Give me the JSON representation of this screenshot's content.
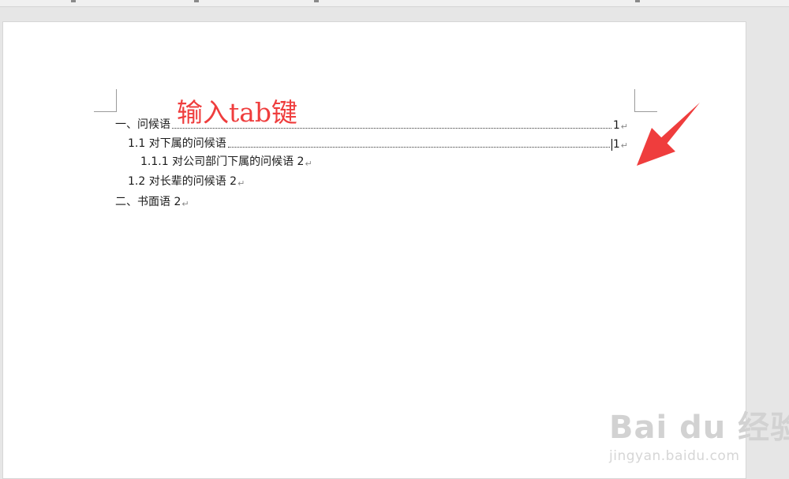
{
  "document": {
    "annotation": "输入tab键",
    "toc": [
      {
        "text": "一、问候语",
        "page": "1",
        "mark": "↵",
        "cursor": false
      },
      {
        "text": "1.1 对下属的问候语",
        "page": "1",
        "mark": "↵",
        "cursor": true
      },
      {
        "text": "1.1.1 对公司部门下属的问候语 2",
        "mark": "↵"
      },
      {
        "text": "1.2 对长辈的问候语 2",
        "mark": "↵"
      },
      {
        "text": "二、书面语 2",
        "mark": "↵"
      }
    ]
  },
  "watermark": {
    "logo": "Bai du 经验",
    "url": "jingyan.baidu.com"
  },
  "colors": {
    "annotation": "#ef3d3d",
    "arrow": "#ef3d3d"
  }
}
